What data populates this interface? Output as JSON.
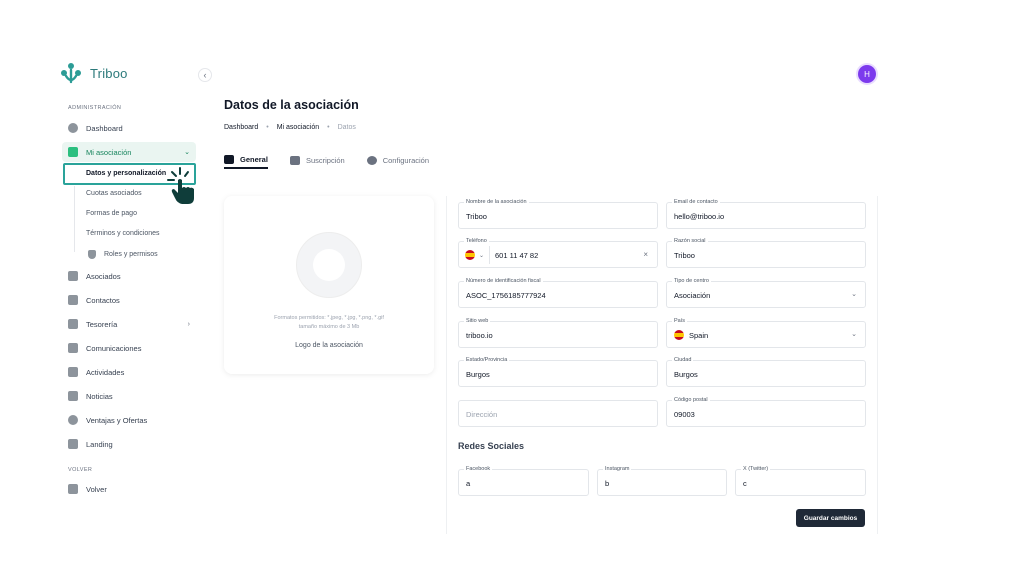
{
  "brand": {
    "name": "Triboo",
    "color": "#2c7a7b"
  },
  "user": {
    "avatar_initial": "H",
    "avatar_color": "#7c3aed"
  },
  "sidebar": {
    "section_admin": "ADMINISTRACIÓN",
    "section_back": "VOLVER",
    "items": [
      {
        "label": "Dashboard",
        "icon": "dashboard-icon"
      },
      {
        "label": "Mi asociación",
        "icon": "document-icon"
      },
      {
        "label": "Asociados",
        "icon": "person-icon"
      },
      {
        "label": "Contactos",
        "icon": "contact-icon"
      },
      {
        "label": "Tesorería",
        "icon": "bank-icon"
      },
      {
        "label": "Comunicaciones",
        "icon": "messages-icon"
      },
      {
        "label": "Actividades",
        "icon": "flag-icon"
      },
      {
        "label": "Noticias",
        "icon": "news-icon"
      },
      {
        "label": "Ventajas y Ofertas",
        "icon": "offer-icon"
      },
      {
        "label": "Landing",
        "icon": "external-icon"
      }
    ],
    "submenu": [
      "Datos y personalización",
      "Cuotas asociados",
      "Formas de pago",
      "Términos y condiciones",
      "Roles y permisos"
    ],
    "back_item": {
      "label": "Volver",
      "icon": "back-arrow-icon"
    }
  },
  "header": {
    "title": "Datos de la asociación",
    "breadcrumb": [
      "Dashboard",
      "Mi asociación",
      "Datos"
    ]
  },
  "tabs": [
    {
      "label": "General",
      "icon": "id-card-icon",
      "active": true
    },
    {
      "label": "Suscripción",
      "icon": "list-icon",
      "active": false
    },
    {
      "label": "Configuración",
      "icon": "gear-icon",
      "active": false
    }
  ],
  "logo_card": {
    "formats_line1": "Formatos permitidos: *.jpeg, *.jpg, *.png, *.gif",
    "formats_line2": "tamaño máximo de 3 Mb",
    "label": "Logo de la asociación"
  },
  "form": {
    "nombre": {
      "label": "Nombre de la asociación",
      "value": "Triboo"
    },
    "email": {
      "label": "Email de contacto",
      "value": "hello@triboo.io"
    },
    "telefono": {
      "label": "Teléfono",
      "value": "601 11 47 82"
    },
    "razon": {
      "label": "Razón social",
      "value": "Triboo"
    },
    "nif": {
      "label": "Número de identificación fiscal",
      "value": "ASOC_1756185777924"
    },
    "tipo": {
      "label": "Tipo de centro",
      "value": "Asociación"
    },
    "web": {
      "label": "Sitio web",
      "value": "triboo.io"
    },
    "pais": {
      "label": "País",
      "value": "Spain"
    },
    "estado": {
      "label": "Estado/Provincia",
      "value": "Burgos"
    },
    "ciudad": {
      "label": "Ciudad",
      "value": "Burgos"
    },
    "direccion": {
      "placeholder": "Dirección"
    },
    "cp": {
      "label": "Código postal",
      "value": "09003"
    },
    "redes_title": "Redes Sociales",
    "facebook": {
      "label": "Facebook",
      "value": "a"
    },
    "instagram": {
      "label": "Instagram",
      "value": "b"
    },
    "twitter": {
      "label": "X (Twitter)",
      "value": "c"
    },
    "save_label": "Guardar cambios"
  }
}
